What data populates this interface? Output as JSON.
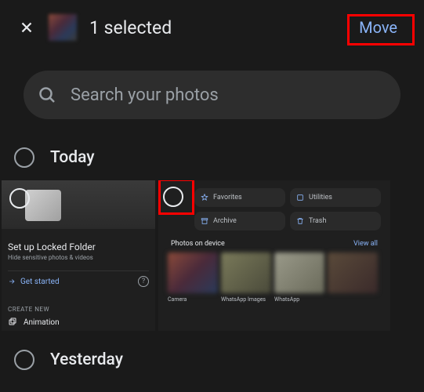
{
  "header": {
    "selected_text": "1 selected",
    "move_label": "Move"
  },
  "search": {
    "placeholder": "Search your photos"
  },
  "sections": {
    "today": "Today",
    "yesterday": "Yesterday"
  },
  "locked_folder": {
    "title": "Set up Locked Folder",
    "subtitle": "Hide sensitive photos & videos",
    "get_started": "Get started",
    "create_new": "CREATE NEW",
    "animation": "Animation"
  },
  "library_card": {
    "pills": {
      "favorites": "Favorites",
      "utilities": "Utilities",
      "archive": "Archive",
      "trash": "Trash"
    },
    "photos_on_device": "Photos on device",
    "view_all": "View all",
    "device_labels": [
      "Camera",
      "WhatsApp Images",
      "WhatsApp"
    ]
  }
}
